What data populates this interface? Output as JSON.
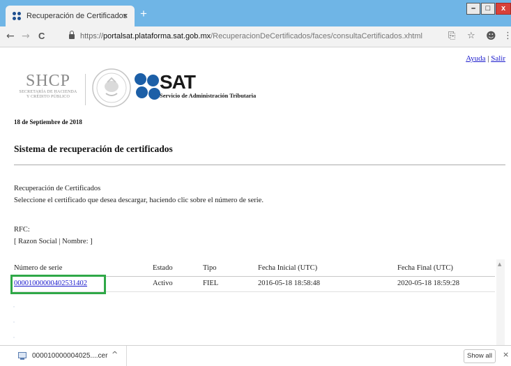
{
  "browser": {
    "tab_title": "Recuperación de Certificados",
    "tab_close": "×",
    "new_tab": "+",
    "window_controls": {
      "minimize": "–",
      "maximize": "□",
      "close": "x"
    },
    "nav": {
      "back": "←",
      "forward": "→",
      "reload": "C"
    },
    "url": {
      "scheme": "https://",
      "host": "portalsat.plataforma.sat.gob.mx",
      "path": "/RecuperacionDeCertificados/faces/consultaCertificados.xhtml"
    },
    "toolbar_icons": {
      "translate": "⎘",
      "bookmark": "☆",
      "profile": "☻",
      "menu": "⋮"
    }
  },
  "page": {
    "links": {
      "help": "Ayuda",
      "separator": "|",
      "exit": "Salir"
    },
    "shcp_logo": {
      "abbr": "SHCP",
      "line1": "SECRETARÍA DE HACIENDA",
      "line2": "Y CRÉDITO PÚBLICO"
    },
    "sat_logo": {
      "abbr": "SAT",
      "subtitle": "Servicio de Administración Tributaria"
    },
    "date": "18 de Septiembre de 2018",
    "title": "Sistema de recuperación de certificados",
    "section_title": "Recuperación de Certificados",
    "instructions": "Seleccione el certificado que desea descargar, haciendo clic sobre el número de serie.",
    "rfc_label": "RFC:",
    "razon_label": "[ Razon Social | Nombre: ]",
    "table": {
      "headers": [
        "Número de serie",
        "Estado",
        "Tipo",
        "Fecha Inicial (UTC)",
        "Fecha Final (UTC)"
      ],
      "rows": [
        {
          "serial": "00001000000402531402",
          "estado": "Activo",
          "tipo": "FIEL",
          "fecha_inicial": "2016-05-18 18:58:48",
          "fecha_final": "2020-05-18 18:59:28"
        }
      ]
    },
    "scroll_arrow": "▲"
  },
  "downloads": {
    "file_name": "000010000004025....cer",
    "chevron": "^",
    "show_all": "Show all",
    "close": "×"
  }
}
